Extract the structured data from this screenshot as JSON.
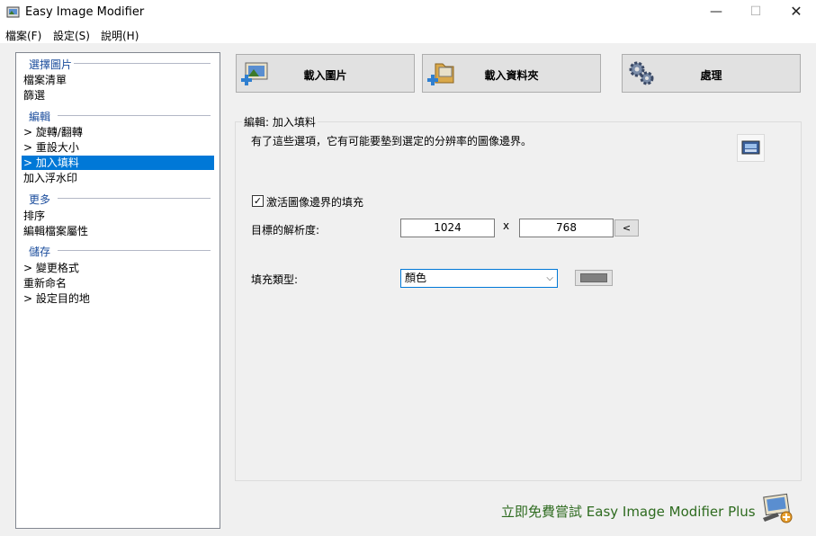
{
  "window": {
    "title": "Easy Image Modifier",
    "controls": {
      "minimize": "—",
      "maximize": "☐",
      "close": "✕"
    }
  },
  "menu": [
    "檔案(F)",
    "設定(S)",
    "說明(H)"
  ],
  "sidebar": {
    "sections": [
      {
        "heading": "選擇圖片",
        "items": [
          {
            "label": "檔案清單"
          },
          {
            "label": "篩選"
          }
        ]
      },
      {
        "heading": "編輯",
        "items": [
          {
            "label": "> 旋轉/翻轉"
          },
          {
            "label": "> 重設大小"
          },
          {
            "label": "> 加入填料",
            "selected": true
          },
          {
            "label": "加入浮水印"
          }
        ]
      },
      {
        "heading": "更多",
        "items": [
          {
            "label": "排序"
          },
          {
            "label": "編輯檔案屬性"
          }
        ]
      },
      {
        "heading": "儲存",
        "items": [
          {
            "label": "> 變更格式"
          },
          {
            "label": "重新命名"
          },
          {
            "label": "> 設定目的地"
          }
        ]
      }
    ]
  },
  "toolbar": {
    "load_images": "載入圖片",
    "load_folder": "載入資料夾",
    "process": "處理"
  },
  "panel": {
    "group_title": "編輯: 加入填料",
    "description": "有了這些選項，它有可能要墊到選定的分辨率的圖像邊界。",
    "activate_checkbox": {
      "label": "激活圖像邊界的填充",
      "checked": true,
      "mark": "✓"
    },
    "target_resolution": {
      "label": "目標的解析度:",
      "width": "1024",
      "times": "x",
      "height": "768",
      "swap_label": "<"
    },
    "fill_type": {
      "label": "填充類型:",
      "selected": "顏色",
      "chevron": "⌵",
      "color": "#808080"
    }
  },
  "footer": {
    "promo": "立即免費嘗試 Easy Image Modifier Plus"
  },
  "colors": {
    "selection": "#0078d7",
    "section_heading": "#1a4c9c",
    "promo": "#2e6b1f"
  },
  "icons": [
    "app-icon",
    "load-images-icon",
    "load-folder-icon",
    "process-gears-icon",
    "picture-icon",
    "promo-icon"
  ]
}
